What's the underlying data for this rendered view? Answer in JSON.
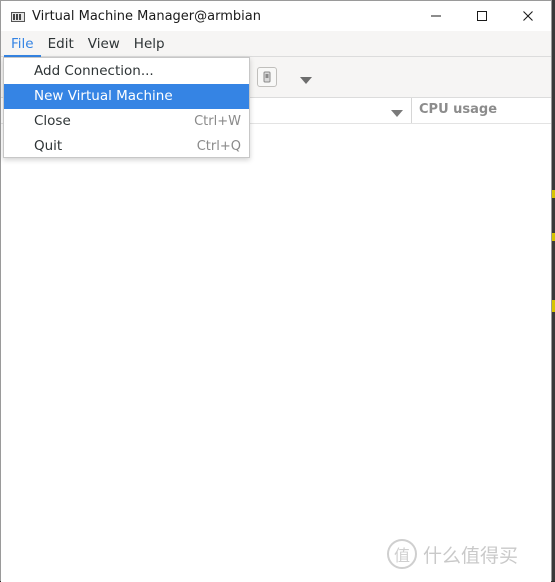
{
  "window": {
    "title": "Virtual Machine Manager@armbian",
    "app_icon": "virt-manager-icon",
    "controls": [
      "minimize-icon",
      "maximize-icon",
      "close-icon"
    ]
  },
  "menubar": {
    "items": [
      {
        "label": "File",
        "active": true
      },
      {
        "label": "Edit"
      },
      {
        "label": "View"
      },
      {
        "label": "Help"
      }
    ]
  },
  "file_menu": {
    "items": [
      {
        "label": "Add Connection...",
        "accel": ""
      },
      {
        "label": "New Virtual Machine",
        "accel": "",
        "highlighted": true
      },
      {
        "label": "Close",
        "accel": "Ctrl+W"
      },
      {
        "label": "Quit",
        "accel": "Ctrl+Q"
      }
    ]
  },
  "list": {
    "columns": [
      {
        "label": "CPU usage"
      }
    ]
  },
  "watermark": {
    "icon_glyph": "值",
    "text": "什么值得买"
  },
  "colors": {
    "accent": "#3584e4",
    "menu_bg": "#f6f5f4"
  }
}
